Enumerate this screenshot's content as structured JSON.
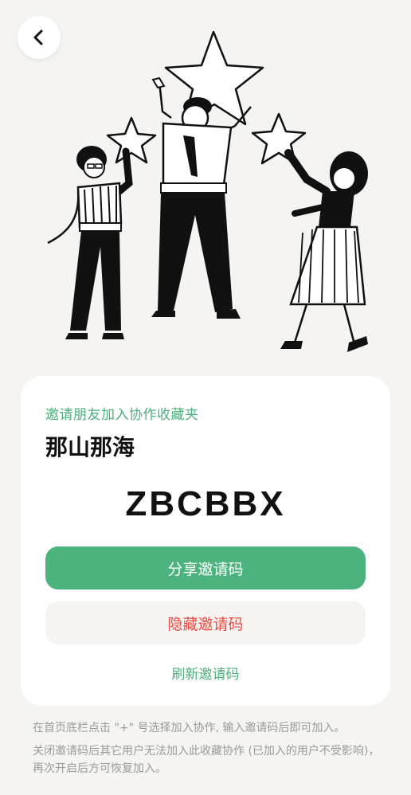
{
  "header": {
    "back_icon": "chevron-left-icon"
  },
  "illustration": {
    "name": "people-holding-stars"
  },
  "card": {
    "subtitle": "邀请朋友加入协作收藏夹",
    "title": "那山那海",
    "invite_code": "ZBCBBX",
    "share_button": "分享邀请码",
    "hide_button": "隐藏邀请码",
    "refresh_link": "刷新邀请码"
  },
  "notes": [
    "在首页底栏点击 \"+\" 号选择加入协作, 输入邀请码后即可加入。",
    "关闭邀请码后其它用户无法加入此收藏协作 (已加入的用户不受影响)，再次开启后方可恢复加入。"
  ],
  "colors": {
    "accent_green": "#4db37e",
    "danger_red": "#ea4b47",
    "background": "#f5f4f1"
  }
}
